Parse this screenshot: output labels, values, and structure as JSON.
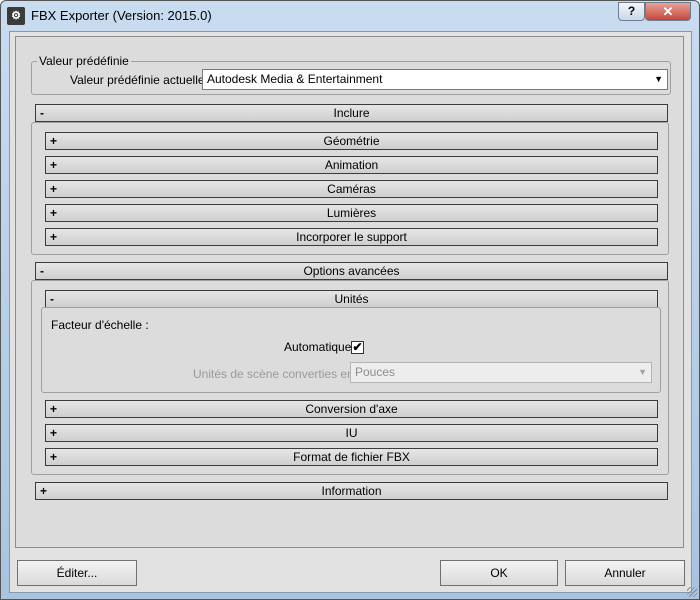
{
  "window": {
    "title": "FBX Exporter (Version: 2015.0)",
    "help_label": "?",
    "close_label": "✕",
    "app_icon": "fbx-app-icon"
  },
  "preset": {
    "group_label": "Valeur prédéfinie",
    "current_label": "Valeur prédéfinie actuelle:",
    "current_value": "Autodesk Media & Entertainment"
  },
  "include": {
    "label": "Inclure",
    "sign": "-",
    "items": [
      {
        "label": "Géométrie",
        "sign": "+"
      },
      {
        "label": "Animation",
        "sign": "+"
      },
      {
        "label": "Caméras",
        "sign": "+"
      },
      {
        "label": "Lumières",
        "sign": "+"
      },
      {
        "label": "Incorporer le support",
        "sign": "+"
      }
    ]
  },
  "advanced": {
    "label": "Options avancées",
    "sign": "-",
    "units": {
      "label": "Unités",
      "sign": "-",
      "scale_factor_label": "Facteur d'échelle :",
      "automatic_label": "Automatique",
      "automatic_checked": "✔",
      "scene_units_label": "Unités de scène converties en:",
      "scene_units_value": "Pouces"
    },
    "items": [
      {
        "label": "Conversion d'axe",
        "sign": "+"
      },
      {
        "label": "IU",
        "sign": "+"
      },
      {
        "label": "Format de fichier FBX",
        "sign": "+"
      }
    ]
  },
  "information": {
    "label": "Information",
    "sign": "+"
  },
  "buttons": {
    "edit": "Éditer...",
    "ok": "OK",
    "cancel": "Annuler"
  },
  "colors": {
    "titlebar": "#b9d1ea",
    "close": "#c6463a",
    "panel": "#dcdcdc"
  }
}
